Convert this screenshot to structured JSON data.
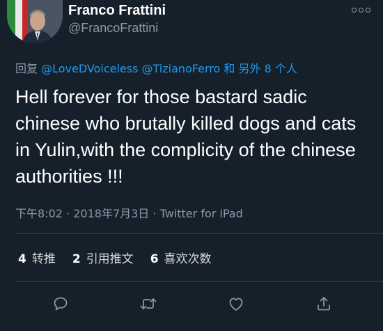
{
  "author": {
    "name": "Franco Frattini",
    "handle": "@FrancoFrattini"
  },
  "reply": {
    "prefix": "回复",
    "mention1": "@LoveDVoiceless",
    "mention2": "@TizianoFerro",
    "suffix": "和 另外 8 个人"
  },
  "tweet": {
    "text": "Hell forever for those bastard sadic chinese who brutally killed dogs and cats in Yulin,with the complicity of the chinese authorities !!!"
  },
  "meta": {
    "time": "下午8:02",
    "sep": "·",
    "date": "2018年7月3日",
    "source": "Twitter for iPad"
  },
  "stats": {
    "retweets_count": "4",
    "retweets_label": "转推",
    "quotes_count": "2",
    "quotes_label": "引用推文",
    "likes_count": "6",
    "likes_label": "喜欢次数"
  },
  "icons": {
    "more": "more-horizontal-icon",
    "reply": "reply-bubble-icon",
    "retweet": "retweet-icon",
    "like": "heart-icon",
    "share": "share-icon"
  },
  "colors": {
    "background": "#15202b",
    "link": "#1d9bf0",
    "secondary_text": "#8b98a5",
    "divider": "#38444d"
  }
}
